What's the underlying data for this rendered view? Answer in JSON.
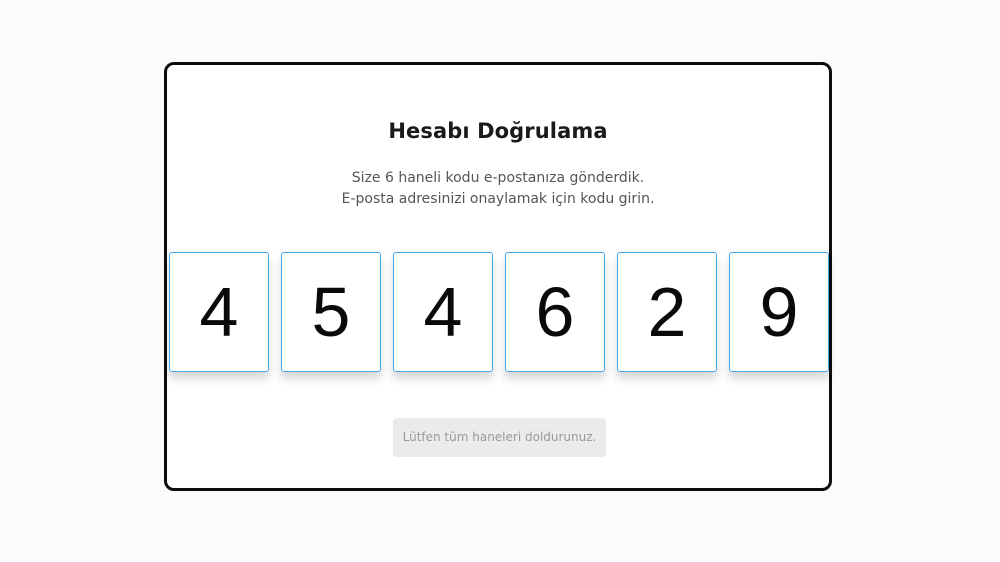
{
  "verification": {
    "title": "Hesabı Doğrulama",
    "subtitle_line1": "Size 6 haneli kodu e-postanıza gönderdik.",
    "subtitle_line2": "E-posta adresinizi onaylamak için kodu girin.",
    "code_digits": [
      "4",
      "5",
      "4",
      "6",
      "2",
      "9"
    ],
    "submit_label": "Lütfen tüm haneleri doldurunuz.",
    "submit_enabled": false
  },
  "colors": {
    "page_background": "#fbfbfd",
    "card_border": "#0d0d0d",
    "digit_border": "#4aa6e8",
    "button_background": "#ebebeb",
    "button_text": "#9a9a9a"
  }
}
